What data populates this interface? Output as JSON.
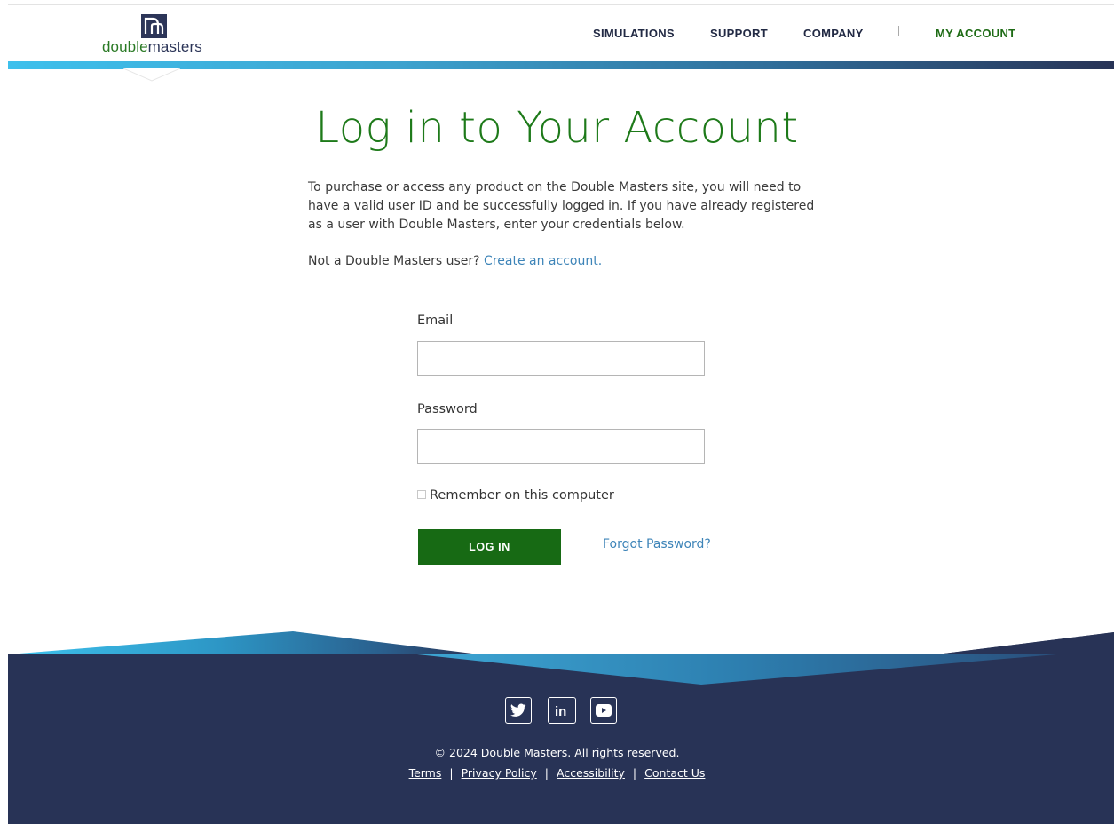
{
  "header": {
    "logo": {
      "word_part1": "double",
      "word_part2": "masters"
    },
    "nav": {
      "simulations": "SIMULATIONS",
      "support": "SUPPORT",
      "company": "COMPANY",
      "my_account": "MY ACCOUNT"
    }
  },
  "main": {
    "title": "Log in to Your Account",
    "intro": "To purchase or access any product on the Double Masters site, you will need to have a valid user ID and be successfully logged in. If you have already registered as a user with Double Masters, enter your credentials below.",
    "signup_prompt": "Not a Double Masters user?",
    "signup_link": "Create an account.",
    "form": {
      "email_label": "Email",
      "email_value": "",
      "password_label": "Password",
      "password_value": "",
      "remember_label": "Remember on this computer",
      "remember_checked": false,
      "login_button": "LOG IN",
      "forgot_link": "Forgot Password?"
    }
  },
  "footer": {
    "social": [
      "twitter-icon",
      "linkedin-icon",
      "youtube-icon"
    ],
    "copyright": "© 2024 Double Masters. All rights reserved.",
    "links": {
      "terms": "Terms",
      "privacy": "Privacy Policy",
      "accessibility": "Accessibility",
      "contact": "Contact Us",
      "separator": "|"
    }
  },
  "colors": {
    "brand_green": "#1e6b15",
    "brand_navy": "#283356",
    "link_blue": "#3d84b8",
    "accent_cyan": "#38b6e6"
  }
}
